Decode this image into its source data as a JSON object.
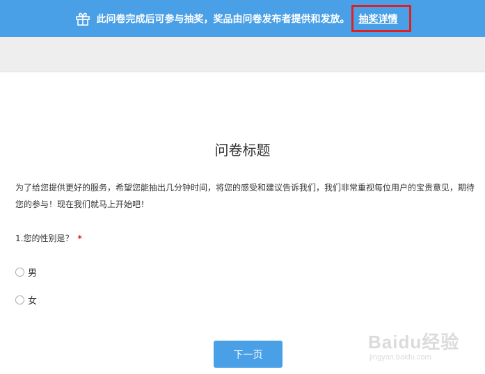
{
  "banner": {
    "text": "此问卷完成后可参与抽奖，奖品由问卷发布者提供和发放。",
    "link_label": "抽奖详情",
    "gift_icon": "gift-icon",
    "background_color": "#4aa0e6",
    "highlight_color": "#e02020"
  },
  "survey": {
    "title": "问卷标题",
    "description": "为了给您提供更好的服务，希望您能抽出几分钟时间，将您的感受和建议告诉我们，我们非常重视每位用户的宝贵意见，期待您的参与！现在我们就马上开始吧！",
    "question": {
      "label": "1.您的性别是？",
      "required_mark": "*",
      "options": [
        {
          "label": "男",
          "selected": false
        },
        {
          "label": "女",
          "selected": false
        }
      ]
    },
    "next_button_label": "下一页"
  },
  "watermark": {
    "main": "Baidu经验",
    "sub": "jingyan.baidu.com"
  }
}
